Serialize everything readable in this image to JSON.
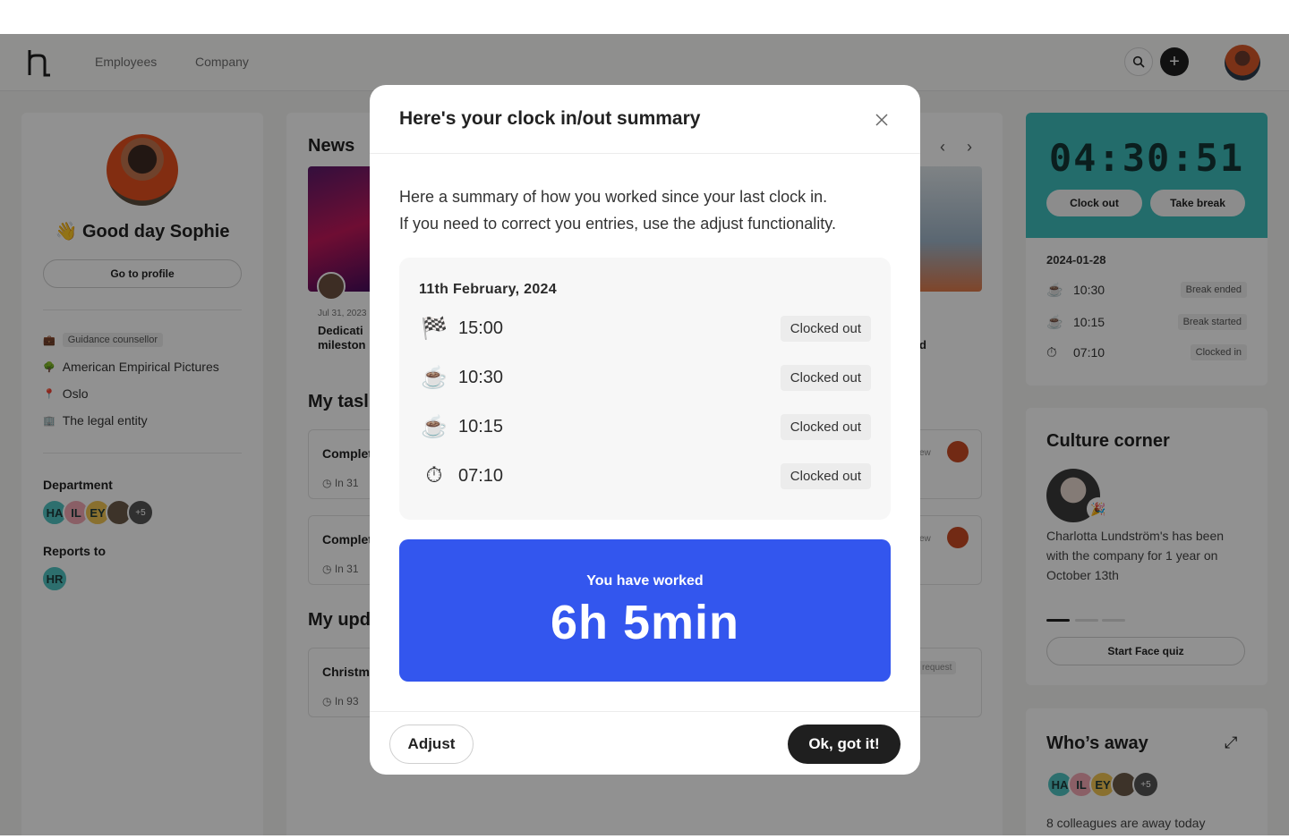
{
  "nav": {
    "items": [
      {
        "label": "Employees"
      },
      {
        "label": "Company"
      }
    ]
  },
  "profile": {
    "greeting": "👋 Good day Sophie",
    "go_to_profile": "Go to profile",
    "role_tag": "Guidance counsellor",
    "company": "American Empirical Pictures",
    "location": "Oslo",
    "legal_entity": "The legal entity",
    "department_label": "Department",
    "department_chips": [
      "HA",
      "IL",
      "EY",
      "+5"
    ],
    "reports_to_label": "Reports to",
    "reports_to_chip": "HR"
  },
  "news": {
    "title": "News",
    "post_date": "Jul 31, 2023",
    "post_title_1": "Dedicati",
    "post_title_2": "mileston",
    "side_fragment": "d"
  },
  "tasks": {
    "title": "My tasl",
    "items": [
      {
        "title": "Complet",
        "meta": "In 31",
        "badge": "ew"
      },
      {
        "title": "Complet",
        "meta": "In 31",
        "badge": "ew"
      }
    ]
  },
  "updates": {
    "title": "My upd",
    "items": [
      {
        "title": "Christm",
        "meta": "In 93",
        "badge": "request"
      }
    ]
  },
  "timer": {
    "value": "04:30:51",
    "clock_out": "Clock out",
    "take_break": "Take break",
    "log_date": "2024-01-28",
    "log": [
      {
        "icon": "coffee-icon",
        "time": "10:30",
        "status": "Break ended"
      },
      {
        "icon": "coffee-icon",
        "time": "10:15",
        "status": "Break started"
      },
      {
        "icon": "stopwatch-icon",
        "time": "07:10",
        "status": "Clocked in"
      }
    ]
  },
  "culture": {
    "title": "Culture corner",
    "text": "Charlotta Lundström's has been with the company for 1 year on October 13th",
    "button": "Start Face quiz"
  },
  "away": {
    "title": "Who’s away",
    "chips": [
      "HA",
      "IL",
      "EY",
      "+5"
    ],
    "text": "8 colleagues are away today"
  },
  "modal": {
    "title": "Here's your clock in/out summary",
    "intro_line_1": "Here a summary of how you worked since your last clock in.",
    "intro_line_2": "If you need to correct you entries, use the adjust functionality.",
    "date": "11th February, 2024",
    "entries": [
      {
        "icon": "checkered-flag-icon",
        "time": "15:00",
        "status": "Clocked out"
      },
      {
        "icon": "coffee-icon",
        "time": "10:30",
        "status": "Clocked out"
      },
      {
        "icon": "coffee-icon",
        "time": "10:15",
        "status": "Clocked out"
      },
      {
        "icon": "stopwatch-icon",
        "time": "07:10",
        "status": "Clocked out"
      }
    ],
    "worked_label": "You have worked",
    "worked_value": "6h 5min",
    "adjust": "Adjust",
    "ok": "Ok, got it!"
  },
  "colors": {
    "accent_blue": "#3356ee",
    "timer_teal": "#3fbfbd",
    "dark_button": "#1f1f1f"
  }
}
